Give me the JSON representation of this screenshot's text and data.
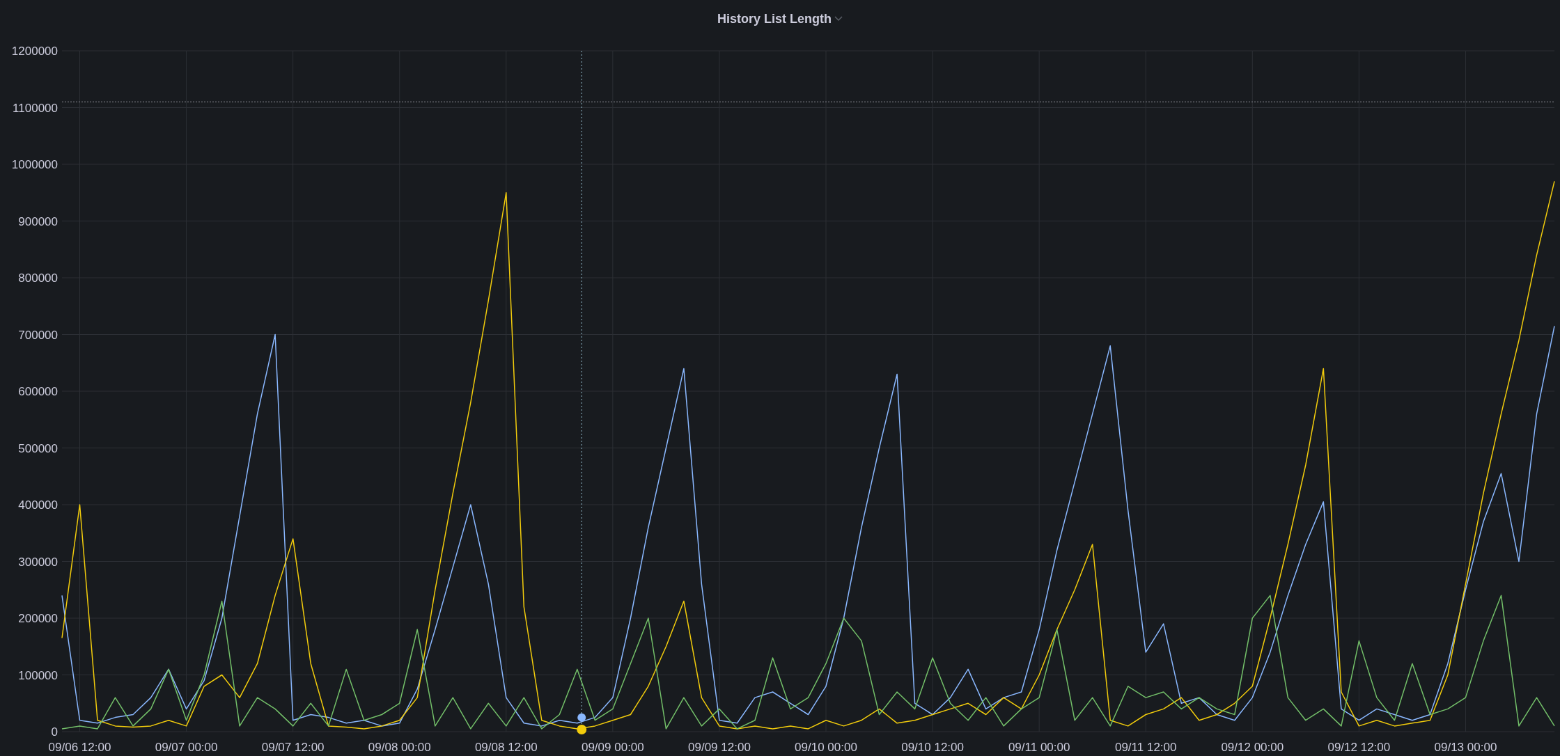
{
  "panel": {
    "title": "History List Length",
    "chart_data": {
      "type": "line",
      "categories": [
        null,
        "09/06 12:00",
        null,
        null,
        null,
        null,
        null,
        "09/07 00:00",
        null,
        null,
        null,
        null,
        null,
        "09/07 12:00",
        null,
        null,
        null,
        null,
        null,
        "09/08 00:00",
        null,
        null,
        null,
        null,
        null,
        "09/08 12:00",
        null,
        null,
        null,
        null,
        null,
        "09/09 00:00",
        null,
        null,
        null,
        null,
        null,
        "09/09 12:00",
        null,
        null,
        null,
        null,
        null,
        "09/10 00:00",
        null,
        null,
        null,
        null,
        null,
        "09/10 12:00",
        null,
        null,
        null,
        null,
        null,
        "09/11 00:00",
        null,
        null,
        null,
        null,
        null,
        "09/11 12:00",
        null,
        null,
        null,
        null,
        null,
        "09/12 00:00",
        null,
        null,
        null,
        null,
        null,
        "09/12 12:00",
        null,
        null,
        null,
        null,
        null,
        "09/13 00:00",
        null,
        null,
        null,
        null,
        null
      ],
      "series": [
        {
          "color": "#8ab8ff",
          "values": [
            240000,
            20000,
            15000,
            25000,
            30000,
            60000,
            110000,
            40000,
            90000,
            200000,
            380000,
            560000,
            700000,
            20000,
            30000,
            25000,
            15000,
            20000,
            10000,
            15000,
            75000,
            180000,
            290000,
            400000,
            260000,
            60000,
            15000,
            10000,
            20000,
            15000,
            25000,
            60000,
            200000,
            360000,
            500000,
            640000,
            260000,
            20000,
            15000,
            60000,
            70000,
            50000,
            30000,
            80000,
            200000,
            360000,
            500000,
            630000,
            50000,
            30000,
            60000,
            110000,
            40000,
            60000,
            70000,
            180000,
            320000,
            440000,
            560000,
            680000,
            390000,
            140000,
            190000,
            50000,
            60000,
            30000,
            20000,
            60000,
            140000,
            240000,
            330000,
            405000,
            40000,
            20000,
            40000,
            30000,
            20000,
            30000,
            120000,
            250000,
            370000,
            455000,
            300000,
            560000,
            715000
          ]
        },
        {
          "color": "#f2cc0c",
          "values": [
            165000,
            400000,
            20000,
            10000,
            8000,
            10000,
            20000,
            10000,
            80000,
            100000,
            60000,
            120000,
            240000,
            340000,
            120000,
            10000,
            8000,
            5000,
            10000,
            20000,
            60000,
            250000,
            420000,
            580000,
            760000,
            950000,
            220000,
            20000,
            10000,
            5000,
            10000,
            20000,
            30000,
            80000,
            150000,
            230000,
            60000,
            10000,
            5000,
            10000,
            5000,
            10000,
            5000,
            20000,
            10000,
            20000,
            40000,
            15000,
            20000,
            30000,
            40000,
            50000,
            30000,
            60000,
            40000,
            100000,
            180000,
            250000,
            330000,
            20000,
            10000,
            30000,
            40000,
            60000,
            20000,
            30000,
            50000,
            80000,
            200000,
            330000,
            470000,
            640000,
            70000,
            10000,
            20000,
            10000,
            15000,
            20000,
            100000,
            260000,
            420000,
            560000,
            690000,
            840000,
            970000
          ]
        },
        {
          "color": "#73bf69",
          "values": [
            5000,
            10000,
            5000,
            60000,
            10000,
            40000,
            110000,
            20000,
            100000,
            230000,
            10000,
            60000,
            40000,
            10000,
            50000,
            10000,
            110000,
            20000,
            30000,
            50000,
            180000,
            10000,
            60000,
            5000,
            50000,
            10000,
            60000,
            5000,
            30000,
            110000,
            20000,
            40000,
            120000,
            200000,
            5000,
            60000,
            10000,
            40000,
            5000,
            20000,
            130000,
            40000,
            60000,
            120000,
            200000,
            160000,
            30000,
            70000,
            40000,
            130000,
            50000,
            20000,
            60000,
            10000,
            40000,
            60000,
            180000,
            20000,
            60000,
            10000,
            80000,
            60000,
            70000,
            40000,
            60000,
            40000,
            30000,
            200000,
            240000,
            60000,
            20000,
            40000,
            10000,
            160000,
            60000,
            20000,
            120000,
            30000,
            40000,
            60000,
            160000,
            240000,
            10000,
            60000,
            10000
          ]
        }
      ],
      "ylim": [
        0,
        1200000
      ],
      "grid": true,
      "ref_lines": [
        {
          "axis": "y",
          "value": 1110000
        }
      ],
      "yticks": [
        0,
        100000,
        200000,
        300000,
        400000,
        500000,
        600000,
        700000,
        800000,
        900000,
        1000000,
        1100000,
        1200000
      ]
    }
  }
}
